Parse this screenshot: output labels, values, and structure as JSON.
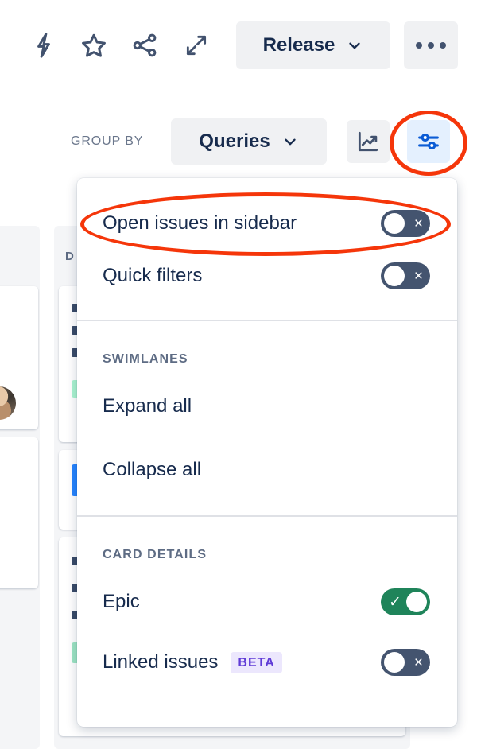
{
  "toolbar": {
    "icons": [
      {
        "name": "lightning-icon",
        "label": "Automation"
      },
      {
        "name": "star-icon",
        "label": "Star"
      },
      {
        "name": "share-icon",
        "label": "Share"
      },
      {
        "name": "expand-icon",
        "label": "Full screen"
      }
    ],
    "release_label": "Release",
    "more_label": "More actions"
  },
  "controls": {
    "group_by_label": "GROUP BY",
    "group_by_value": "Queries",
    "chart_icon": "insights-chart-icon",
    "settings_icon": "board-settings-sliders-icon"
  },
  "popup": {
    "view_settings": [
      {
        "label": "Open issues in sidebar",
        "state": "off",
        "mark": "×"
      },
      {
        "label": "Quick filters",
        "state": "off",
        "mark": "×"
      }
    ],
    "swimlanes": {
      "heading": "SWIMLANES",
      "items": [
        {
          "label": "Expand all"
        },
        {
          "label": "Collapse all"
        }
      ]
    },
    "card_details": {
      "heading": "CARD DETAILS",
      "items": [
        {
          "label": "Epic",
          "badge": "",
          "state": "on",
          "mark": "✓"
        },
        {
          "label": "Linked issues",
          "badge": "BETA",
          "state": "off",
          "mark": "×"
        }
      ]
    }
  },
  "background_board": {
    "column_title": "D",
    "card_text_placeholder": ""
  },
  "annotations": [
    {
      "name": "settings-highlight",
      "shape": "ellipse",
      "color": "#f5360a"
    },
    {
      "name": "open-issues-highlight",
      "shape": "ellipse",
      "color": "#f5360a"
    }
  ],
  "colors": {
    "accent_blue": "#0b5cd5",
    "toggle_off": "#44546f",
    "toggle_on": "#1f845a",
    "badge_bg": "#ece7fd",
    "badge_fg": "#5f3bd6",
    "annotation_red": "#f5360a",
    "text_primary": "#172b4d",
    "text_muted": "#5e6c84"
  }
}
